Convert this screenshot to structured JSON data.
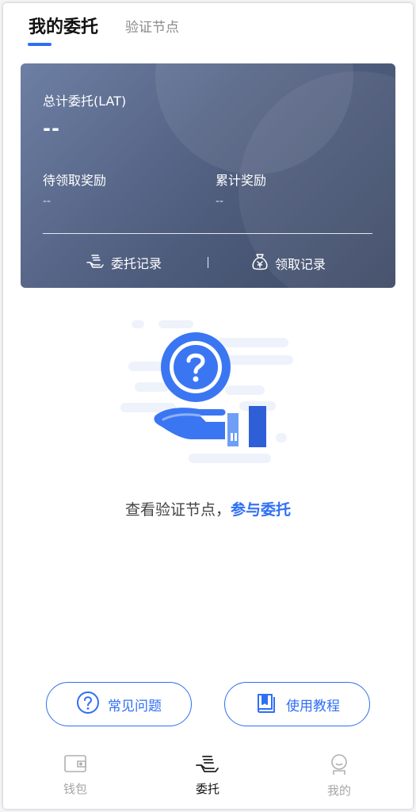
{
  "tabs": {
    "active": "我的委托",
    "inactive": "验证节点"
  },
  "card": {
    "total_label": "总计委托(LAT)",
    "total_value": "--",
    "pending_label": "待领取奖励",
    "pending_value": "--",
    "accumulated_label": "累计奖励",
    "accumulated_value": "--",
    "links": {
      "delegate_record": "委托记录",
      "claim_record": "领取记录"
    }
  },
  "empty_state": {
    "prompt_text": "查看验证节点，",
    "prompt_link": "参与委托"
  },
  "buttons": {
    "faq": "常见问题",
    "tutorial": "使用教程"
  },
  "bottom_nav": {
    "wallet": "钱包",
    "delegate": "委托",
    "me": "我的"
  },
  "colors": {
    "accent": "#2f6ff4",
    "card_gradient_start": "#6d7fa4",
    "card_gradient_end": "#3d4a66"
  },
  "icons": {
    "delegate_record": "hand-coins-icon",
    "claim_record": "money-bag-icon",
    "faq": "question-circle-icon",
    "tutorial": "book-icon",
    "wallet": "wallet-icon",
    "delegate": "hand-coins-icon",
    "me": "user-icon"
  }
}
